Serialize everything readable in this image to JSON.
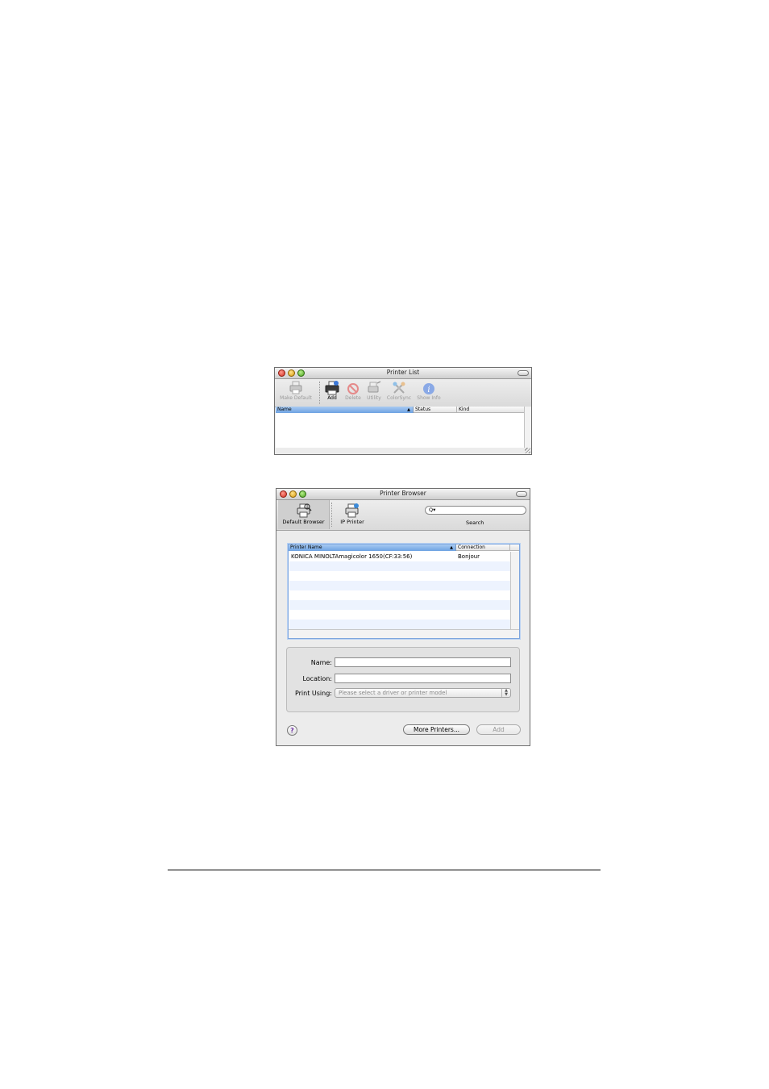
{
  "printer_list": {
    "title": "Printer List",
    "toolbar": [
      {
        "label": "Make Default",
        "icon": "printer-icon",
        "enabled": false
      },
      {
        "label": "Add",
        "icon": "add-printer-icon",
        "enabled": true
      },
      {
        "label": "Delete",
        "icon": "delete-icon",
        "enabled": false
      },
      {
        "label": "Utility",
        "icon": "utility-icon",
        "enabled": false
      },
      {
        "label": "ColorSync",
        "icon": "colorsync-icon",
        "enabled": false
      },
      {
        "label": "Show Info",
        "icon": "info-icon",
        "enabled": false
      }
    ],
    "columns": [
      "Name",
      "Status",
      "Kind"
    ],
    "sort_indicator": "▲"
  },
  "printer_browser": {
    "title": "Printer Browser",
    "tabs": [
      {
        "label": "Default Browser",
        "icon": "default-browser-icon",
        "selected": true
      },
      {
        "label": "IP Printer",
        "icon": "ip-printer-icon",
        "selected": false
      }
    ],
    "search": {
      "label": "Search",
      "placeholder": "Q▾"
    },
    "table": {
      "columns": [
        "Printer Name",
        "Connection"
      ],
      "sort_indicator": "▲",
      "rows": [
        {
          "name": "KONICA MINOLTAmagicolor 1650(CF:33:56)",
          "connection": "Bonjour"
        }
      ]
    },
    "form": {
      "name_label": "Name:",
      "name_value": "",
      "location_label": "Location:",
      "location_value": "",
      "print_using_label": "Print Using:",
      "print_using_value": "Please select a driver or printer model"
    },
    "buttons": {
      "help": "?",
      "more_printers": "More Printers...",
      "add": "Add"
    }
  },
  "colors": {
    "selection_blue": "#7fb2ec",
    "stripe_blue": "#edf3fe",
    "window_bg": "#ececec"
  }
}
